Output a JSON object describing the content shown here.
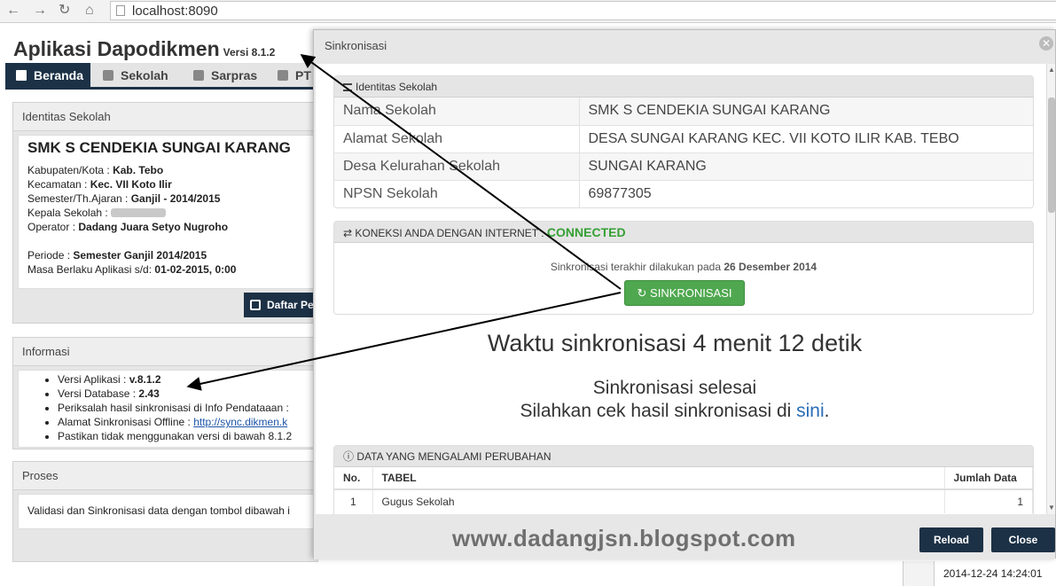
{
  "browser": {
    "url": "localhost:8090"
  },
  "app": {
    "title": "Aplikasi Dapodikmen",
    "version_label": "Versi 8.1.2",
    "tabs": [
      "Beranda",
      "Sekolah",
      "Sarpras",
      "PT"
    ],
    "identitas_panel": {
      "title": "Identitas Sekolah",
      "school_name": "SMK S CENDEKIA SUNGAI KARANG",
      "rows": [
        {
          "label": "Kabupaten/Kota : ",
          "value": "Kab. Tebo"
        },
        {
          "label": "Kecamatan : ",
          "value": "Kec. VII Koto Ilir"
        },
        {
          "label": "Semester/Th.Ajaran : ",
          "value": "Ganjil - 2014/2015"
        },
        {
          "label": "Kepala Sekolah : ",
          "value": ""
        },
        {
          "label": "Operator : ",
          "value": "Dadang Juara Setyo Nugroho"
        },
        {
          "label": "Periode : ",
          "value": "Semester Ganjil 2014/2015"
        },
        {
          "label": "Masa Berlaku Aplikasi s/d: ",
          "value": "01-02-2015, 0:00"
        }
      ],
      "daftar_button": "Daftar Pe"
    },
    "informasi_panel": {
      "title": "Informasi",
      "items": [
        {
          "label": "Versi Aplikasi : ",
          "value": "v.8.1.2"
        },
        {
          "label": "Versi Database : ",
          "value": "2.43"
        },
        {
          "label": "Periksalah hasil sinkronisasi di Info Pendataaan :",
          "value": ""
        },
        {
          "label": "Alamat Sinkronisasi Offline : ",
          "link": "http://sync.dikmen.k"
        },
        {
          "label": "Pastikan tidak menggunakan versi di bawah 8.1.2",
          "value": ""
        }
      ]
    },
    "proses_panel": {
      "title": "Proses",
      "text": "Validasi dan Sinkronisasi data dengan tombol dibawah i"
    },
    "statusbar_datetime": "2014-12-24 14:24:01"
  },
  "modal": {
    "title": "Sinkronisasi",
    "identitas": {
      "header": "Identitas Sekolah",
      "rows": [
        {
          "key": "Nama Sekolah",
          "value": "SMK S CENDEKIA SUNGAI KARANG"
        },
        {
          "key": "Alamat Sekolah",
          "value": "DESA SUNGAI KARANG KEC. VII KOTO ILIR KAB. TEBO"
        },
        {
          "key": "Desa Kelurahan Sekolah",
          "value": "SUNGAI KARANG"
        },
        {
          "key": "NPSN Sekolah",
          "value": "69877305"
        }
      ]
    },
    "koneksi": {
      "header": "KONEKSI ANDA DENGAN INTERNET : ",
      "status": "CONNECTED",
      "last_sync_text": "Sinkronisasi terakhir dilakukan pada ",
      "last_sync_date": "26 Desember 2014",
      "button": "SINKRONISASI"
    },
    "waktu": "Waktu sinkronisasi 4 menit 12 detik",
    "selesai": "Sinkronisasi selesai",
    "cek_text": "Silahkan cek hasil sinkronisasi di ",
    "cek_link": "sini",
    "cek_end": ".",
    "perubahan": {
      "header": "DATA YANG MENGALAMI PERUBAHAN",
      "columns": [
        "No.",
        "TABEL",
        "Jumlah Data"
      ],
      "rows": [
        {
          "no": "1",
          "tabel": "Gugus Sekolah",
          "jumlah": "1"
        }
      ]
    },
    "watermark": "www.dadangjsn.blogspot.com",
    "buttons": {
      "reload": "Reload",
      "close": "Close"
    }
  },
  "colors": {
    "navy": "#1c3146",
    "connected": "#35a035",
    "sync_button": "#4fa84f",
    "link": "#2a6db6"
  }
}
